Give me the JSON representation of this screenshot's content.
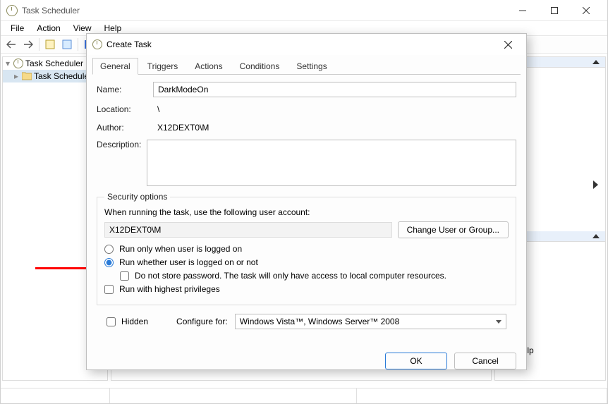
{
  "window": {
    "title": "Task Scheduler",
    "menu": [
      "File",
      "Action",
      "View",
      "Help"
    ]
  },
  "tree": {
    "root": "Task Scheduler (L",
    "child": "Task Schedule"
  },
  "actions_panel": {
    "help": "Help"
  },
  "dialog": {
    "title": "Create Task",
    "tabs": [
      "General",
      "Triggers",
      "Actions",
      "Conditions",
      "Settings"
    ],
    "name_label": "Name:",
    "name_value": "DarkModeOn",
    "location_label": "Location:",
    "location_value": "\\",
    "author_label": "Author:",
    "author_value": "X12DEXT0\\M",
    "description_label": "Description:",
    "description_value": "",
    "security": {
      "legend": "Security options",
      "prompt": "When running the task, use the following user account:",
      "account": "X12DEXT0\\M",
      "change_btn": "Change User or Group...",
      "radio_logged_on": "Run only when user is logged on",
      "radio_whether": "Run whether user is logged on or not",
      "no_store_pw": "Do not store password.  The task will only have access to local computer resources.",
      "highest_priv": "Run with highest privileges"
    },
    "hidden_label": "Hidden",
    "configure_label": "Configure for:",
    "configure_value": "Windows Vista™, Windows Server™ 2008",
    "ok": "OK",
    "cancel": "Cancel"
  }
}
